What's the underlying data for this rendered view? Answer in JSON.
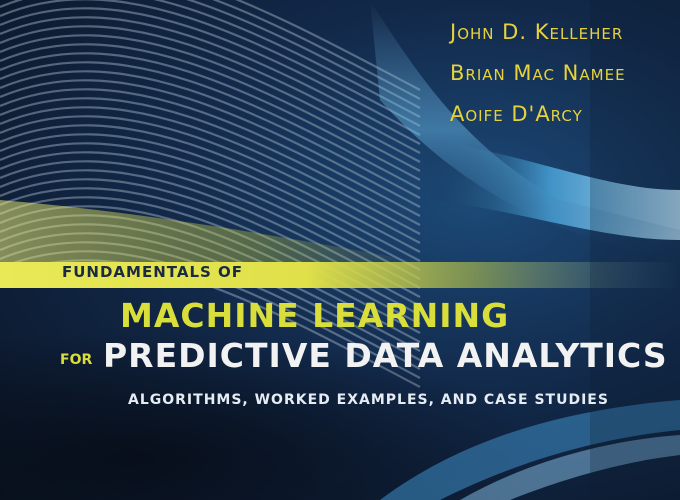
{
  "cover": {
    "authors": [
      "John D. Kelleher",
      "Brian Mac Namee",
      "Aoife D'Arcy"
    ],
    "series_prefix": "FUNDAMENTALS OF",
    "title_line1": "MACHINE LEARNING",
    "title_for": "FOR",
    "title_line2": "PREDICTIVE DATA ANALYTICS",
    "subtitle": "ALGORITHMS, WORKED EXAMPLES, AND CASE STUDIES"
  },
  "colors": {
    "accent_yellow": "#d9de3a",
    "author_yellow": "#e8d23c",
    "band_yellow": "#dfe04a",
    "background_navy": "#12294a",
    "glow_blue": "#5fb6e6"
  }
}
